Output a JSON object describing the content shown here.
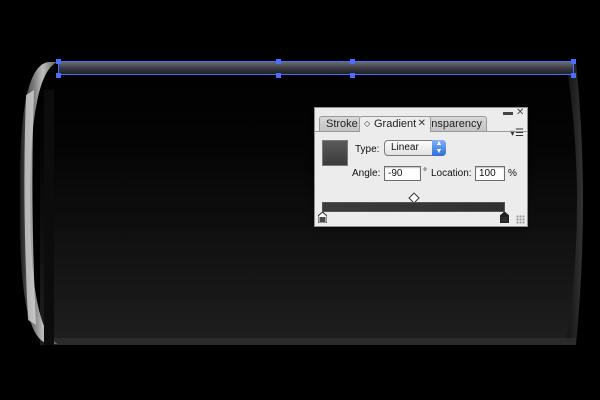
{
  "panel": {
    "tabs": [
      {
        "label": "Stroke",
        "active": false
      },
      {
        "label": "Gradient",
        "active": true
      },
      {
        "label": "nsparency",
        "active": false
      }
    ],
    "collapse_glyph": "▬",
    "close_glyph": "✕",
    "tab_arrows_glyph": "◇",
    "tab_close_glyph": "✕",
    "menu_glyph": "▾☰",
    "type_label": "Type:",
    "type_value": "Linear",
    "angle_label": "Angle:",
    "angle_value": "-90",
    "degree_symbol": "°",
    "location_label": "Location:",
    "location_value": "100",
    "percent_symbol": "%"
  },
  "colors": {
    "selection": "#4a6cff",
    "canvas_bg": "#000000",
    "panel_bg": "#ececec",
    "select_accent": "#2f6ed8"
  },
  "icons": {
    "select_arrows": "updown-arrows-icon",
    "stop": "color-stop-icon",
    "midpoint": "diamond-icon"
  }
}
